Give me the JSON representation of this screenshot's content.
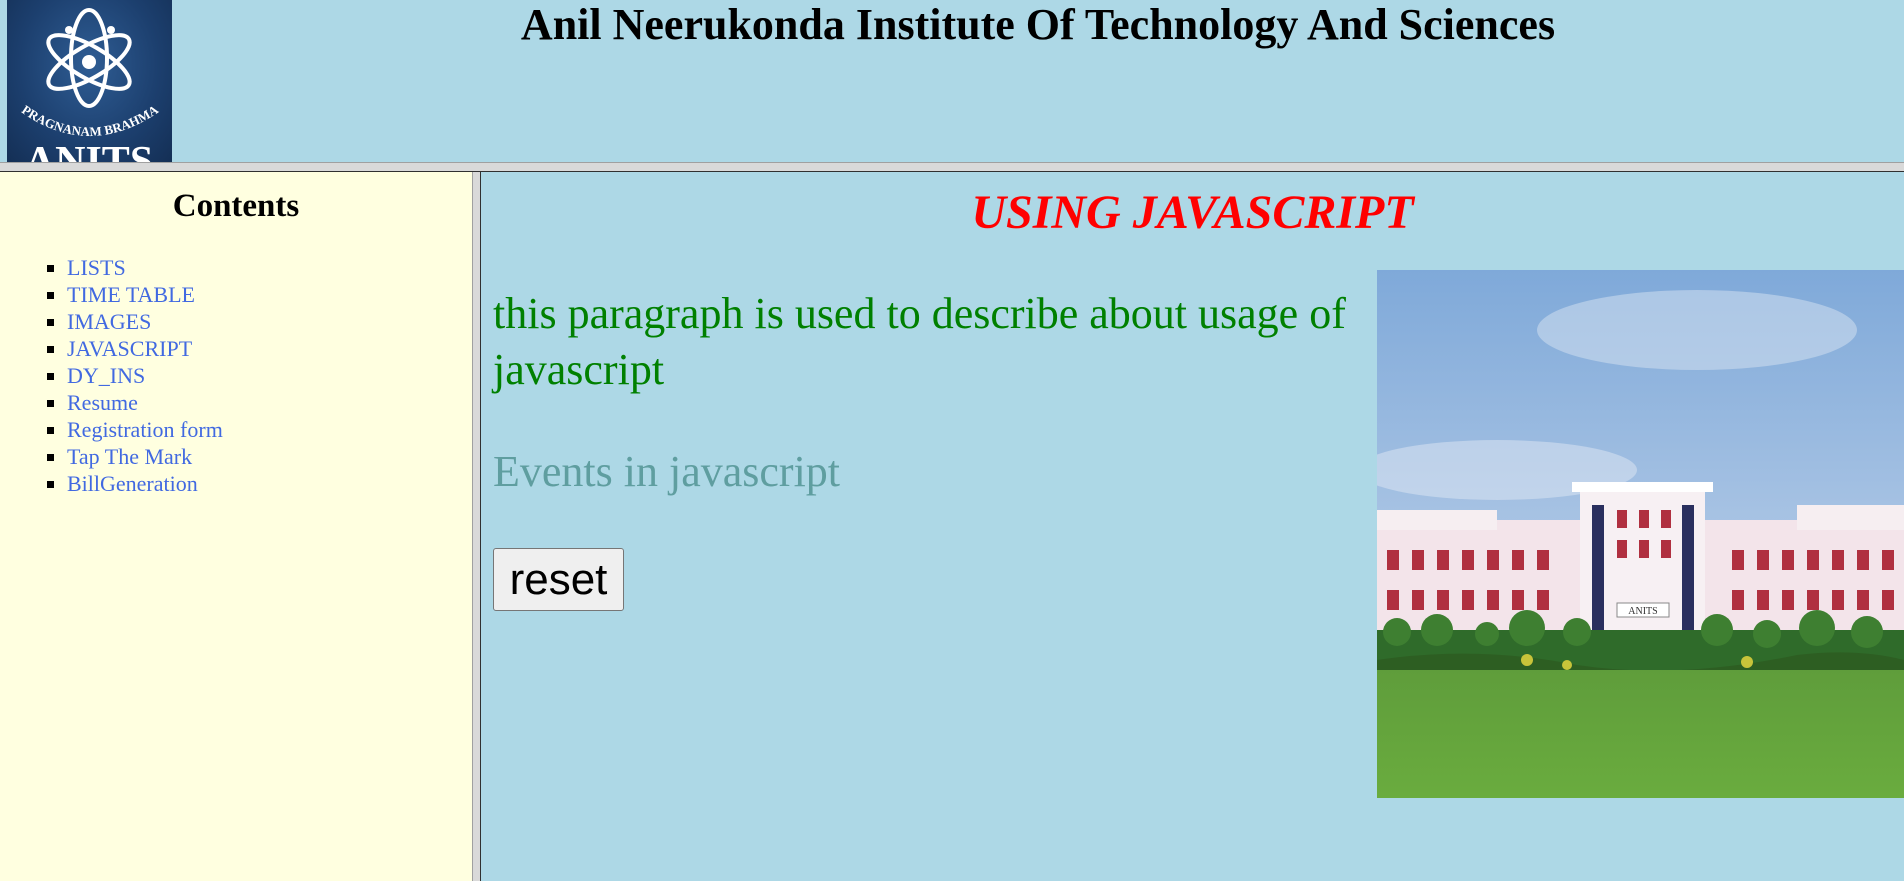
{
  "header": {
    "title": "Anil Neerukonda Institute Of Technology And Sciences",
    "logo": {
      "motto": "PRAGNANAM BRAHMA",
      "abbreviation": "ANITS"
    }
  },
  "sidebar": {
    "title": "Contents",
    "items": [
      {
        "label": "LISTS"
      },
      {
        "label": "TIME TABLE"
      },
      {
        "label": "IMAGES"
      },
      {
        "label": "JAVASCRIPT"
      },
      {
        "label": "DY_INS"
      },
      {
        "label": "Resume"
      },
      {
        "label": "Registration form"
      },
      {
        "label": "Tap The Mark"
      },
      {
        "label": "BillGeneration"
      }
    ]
  },
  "main": {
    "heading": "USING JAVASCRIPT",
    "paragraph": "this paragraph is used to describe about usage of javascript",
    "events_text": "Events in javascript",
    "reset_label": "reset",
    "campus_sign": "ANITS"
  },
  "colors": {
    "background": "#add8e6",
    "sidebar_background": "#ffffe0",
    "heading": "#ff0000",
    "paragraph": "#008000",
    "events_text": "#5f9ea0",
    "link": "#4169e1"
  }
}
